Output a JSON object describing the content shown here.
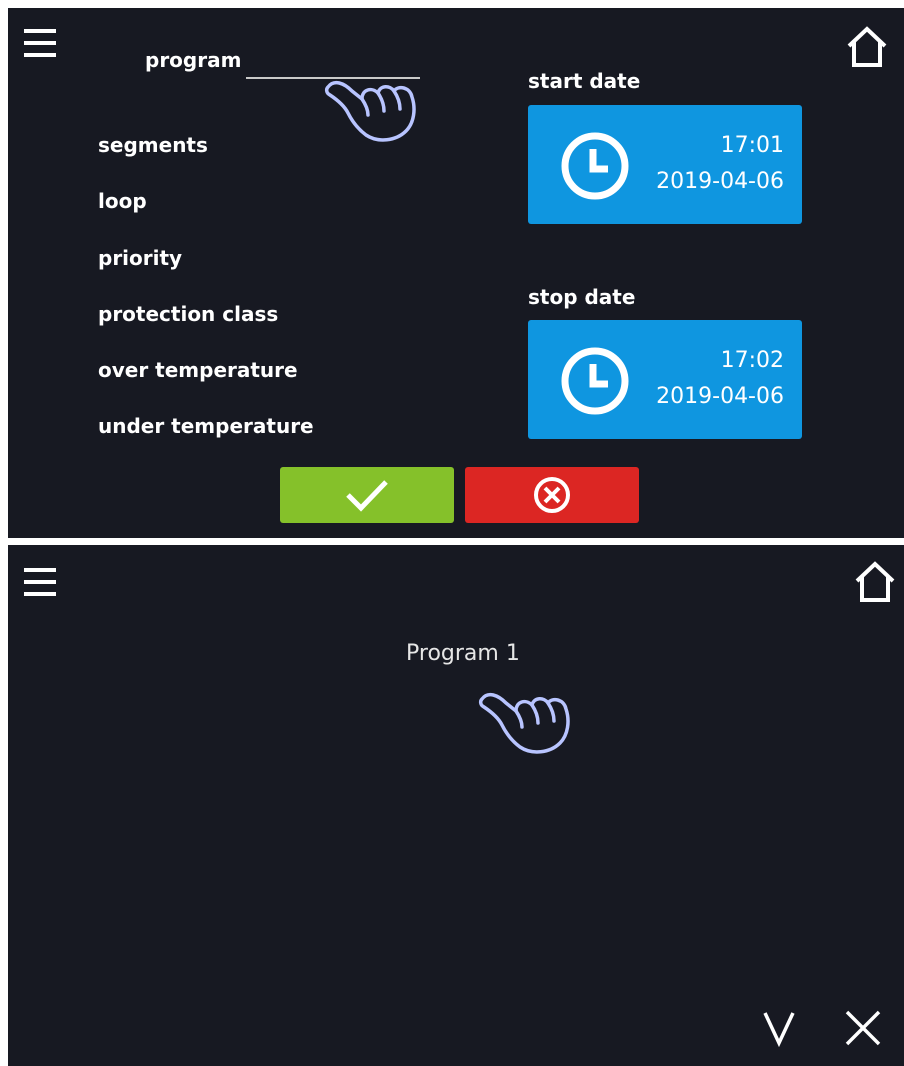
{
  "top_screen": {
    "menu_icon": "hamburger-menu-icon",
    "home_icon": "home-icon",
    "program_label": "program",
    "fields": [
      "segments",
      "loop",
      "priority",
      "protection class",
      "over temperature",
      "under temperature"
    ],
    "start": {
      "label": "start date",
      "time": "17:01",
      "date": "2019-04-06"
    },
    "stop": {
      "label": "stop date",
      "time": "17:02",
      "date": "2019-04-06"
    },
    "confirm_icon": "checkmark-icon",
    "cancel_icon": "cancel-circle-icon",
    "colors": {
      "background": "#171922",
      "card": "#0f96e0",
      "confirm": "#85c12a",
      "cancel": "#dc2623"
    }
  },
  "bottom_screen": {
    "menu_icon": "hamburger-menu-icon",
    "home_icon": "home-icon",
    "program_item": "Program 1",
    "down_icon": "chevron-down-icon",
    "close_icon": "close-icon"
  }
}
